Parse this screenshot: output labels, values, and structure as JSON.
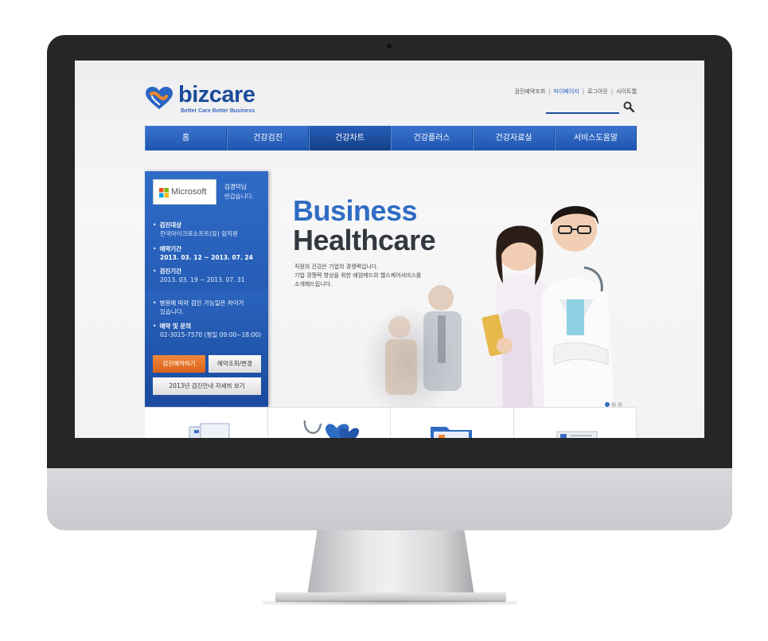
{
  "brand": {
    "name": "bizcare",
    "slogan": "Better Care Better Business",
    "color": "#1b4b9b"
  },
  "util_links": [
    {
      "label": "검진예약조회",
      "active": false
    },
    {
      "label": "마이페이지",
      "active": true
    },
    {
      "label": "로그아웃",
      "active": false
    },
    {
      "label": "사이트맵",
      "active": false
    }
  ],
  "nav": {
    "items": [
      "홈",
      "건강검진",
      "건강차트",
      "건강플러스",
      "건강자료실",
      "서비스도움말"
    ],
    "active_index": 2
  },
  "side": {
    "company": "Microsoft",
    "greeting_name": "김경덕님",
    "greeting_msg": "반갑습니다.",
    "target_label": "검진대상",
    "target_value": "한국마이크로소프트(유) 임직원",
    "reserve_label": "예약기간",
    "reserve_value": "2013. 03. 12 ~ 2013. 07. 24",
    "exam_label": "검진기간",
    "exam_value": "2013. 03. 19 ~ 2013. 07. 31",
    "notice_line1": "병원에 따라 검진 가능일은 차이가",
    "notice_line2": "있습니다.",
    "contact_label": "예약 및 문의",
    "contact_value": "02-3015-7570 (평일 09:00~18:00)",
    "btn_reserve": "검진예약하기",
    "btn_change": "예약조회/변경",
    "btn_guide": "2013년 검진안내 자세히 보기"
  },
  "hero": {
    "title1": "Business",
    "title2": "Healthcare",
    "desc1": "직원의 건강은 기업의 경쟁력입니다.",
    "desc2": "기업 경쟁력 향상을 위한 에임메드의 헬스케어서비스를",
    "desc3": "소개해드립니다.",
    "slide_count": 3,
    "active_slide": 1
  },
  "colors": {
    "nav_blue": "#2f6cc2",
    "accent_orange": "#e0702a"
  }
}
